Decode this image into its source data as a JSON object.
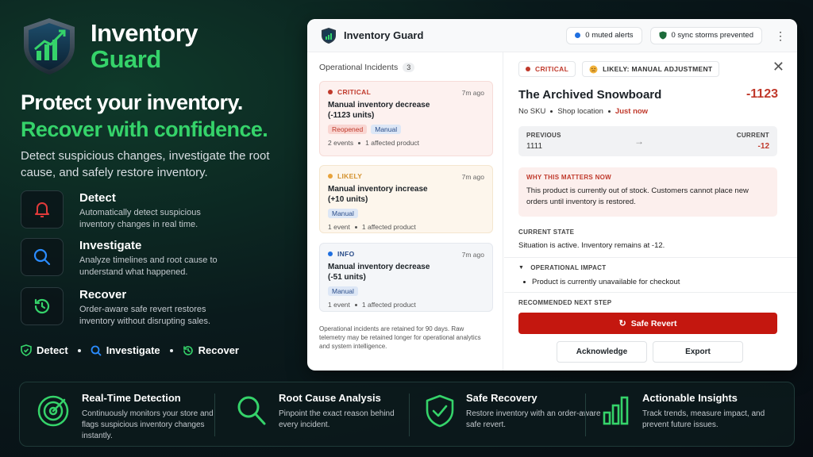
{
  "brand": {
    "name": "Inventory",
    "sub": "Guard"
  },
  "hero": {
    "line1": "Protect your inventory.",
    "line2": "Recover with confidence.",
    "subhead": "Detect suspicious changes, investigate the root cause, and safely restore inventory."
  },
  "features": [
    {
      "title": "Detect",
      "desc": "Automatically detect suspicious inventory changes in real time.",
      "icon": "bell-icon"
    },
    {
      "title": "Investigate",
      "desc": "Analyze timelines and root cause to understand what happened.",
      "icon": "search-icon"
    },
    {
      "title": "Recover",
      "desc": "Order-aware safe revert restores inventory without disrupting sales.",
      "icon": "history-icon"
    }
  ],
  "mini_steps": [
    "Detect",
    "Investigate",
    "Recover"
  ],
  "panel": {
    "title": "Inventory Guard",
    "muted_alerts": "0 muted alerts",
    "sync_storms": "0 sync storms prevented",
    "incidents_label": "Operational Incidents",
    "incidents_count": "3",
    "incidents": [
      {
        "severity": "CRITICAL",
        "ago": "7m ago",
        "title": "Manual inventory decrease (-1123 units)",
        "tags": [
          "Reopened",
          "Manual"
        ],
        "events": "2 events",
        "affected": "1 affected product",
        "color": "#d0342c"
      },
      {
        "severity": "LIKELY",
        "ago": "7m ago",
        "title": "Manual inventory increase (+10 units)",
        "tags": [
          "Manual"
        ],
        "events": "1 event",
        "affected": "1 affected product",
        "color": "#e8a33c"
      },
      {
        "severity": "INFO",
        "ago": "7m ago",
        "title": "Manual inventory decrease (-51 units)",
        "tags": [
          "Manual"
        ],
        "events": "1 event",
        "affected": "1 affected product",
        "color": "#1f6fe0"
      }
    ],
    "retention_note": "Operational incidents are retained for 90 days. Raw telemetry may be retained longer for operational analytics and system intelligence.",
    "detail": {
      "badge_severity": "CRITICAL",
      "badge_cause": "LIKELY: MANUAL ADJUSTMENT",
      "product": "The Archived Snowboard",
      "delta": "-1123",
      "sku": "No SKU",
      "location": "Shop location",
      "time": "Just now",
      "previous_label": "PREVIOUS",
      "previous_value": "1111",
      "current_label": "CURRENT",
      "current_value": "-12",
      "why_heading": "WHY THIS MATTERS NOW",
      "why_text": "This product is currently out of stock. Customers cannot place new orders until inventory is restored.",
      "state_heading": "CURRENT STATE",
      "state_text": "Situation is active. Inventory remains at -12.",
      "impact_heading": "OPERATIONAL IMPACT",
      "impact_item": "Product is currently unavailable for checkout",
      "next_heading": "RECOMMENDED NEXT STEP",
      "revert_label": "Safe Revert",
      "ack_label": "Acknowledge",
      "export_label": "Export"
    }
  },
  "benefits": [
    {
      "title": "Real-Time Detection",
      "desc": "Continuously monitors your store and flags suspicious inventory changes instantly.",
      "icon": "target-icon"
    },
    {
      "title": "Root Cause Analysis",
      "desc": "Pinpoint the exact reason behind every incident.",
      "icon": "magnifier-icon"
    },
    {
      "title": "Safe Recovery",
      "desc": "Restore inventory with an order-aware safe revert.",
      "icon": "shield-check-icon"
    },
    {
      "title": "Actionable Insights",
      "desc": "Track trends, measure impact, and prevent future issues.",
      "icon": "bar-chart-icon"
    }
  ],
  "colors": {
    "accent": "#35d36a",
    "critical": "#c4170f",
    "bg": "#0a1a1c"
  }
}
